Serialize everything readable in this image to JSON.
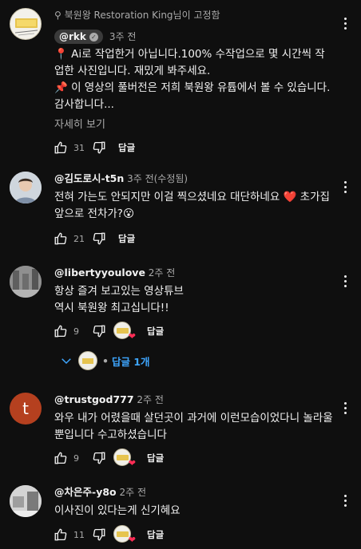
{
  "comments": [
    {
      "pinned_label": "북원왕 Restoration King님이 고정함",
      "author": "@rkk",
      "time": "3주 전",
      "text": "📍 Ai로 작업한거 아닙니다.100% 수작업으로 몇 시간씩 작업한 사진입니다. 재밌게 봐주세요.\n📌 이 영상의 풀버전은 저희 북원왕 유튭에서 볼 수 있습니다.감사합니다...",
      "more": "자세히 보기",
      "likes": "31",
      "reply": "답글"
    },
    {
      "author": "@김도로시-t5n",
      "time": "3주 전(수정됨)",
      "text": "전혀 가는도 안되지만  이걸  찍으셨네요   대단하네요 ❤️ 초가집 앞으로 전차가?😮",
      "likes": "21",
      "reply": "답글"
    },
    {
      "author": "@libertyyoulove",
      "time": "2주 전",
      "text": "항상 즐겨 보고있는 영상튜브\n역시 북원왕 최고십니다!!",
      "likes": "9",
      "reply": "답글",
      "replies_toggle": "답글 1개"
    },
    {
      "author": "@trustgod777",
      "time": "2주 전",
      "avatar_letter": "t",
      "text": "와우  내가 어렸을때 살던곳이 과거에 이런모습이었다니 놀라울뿐입니다 수고하셨습니다",
      "likes": "9",
      "reply": "답글"
    },
    {
      "author": "@차은주-y8o",
      "time": "2주 전",
      "text": "이사진이 있다는게 신기혜요",
      "likes": "11",
      "reply": "답글"
    }
  ],
  "logo_text": "북원왕",
  "colors": {
    "background": "#0f0f0f",
    "link": "#3ea6ff",
    "heart": "#ff2d55",
    "trustgod_avatar": "#b5401f"
  }
}
